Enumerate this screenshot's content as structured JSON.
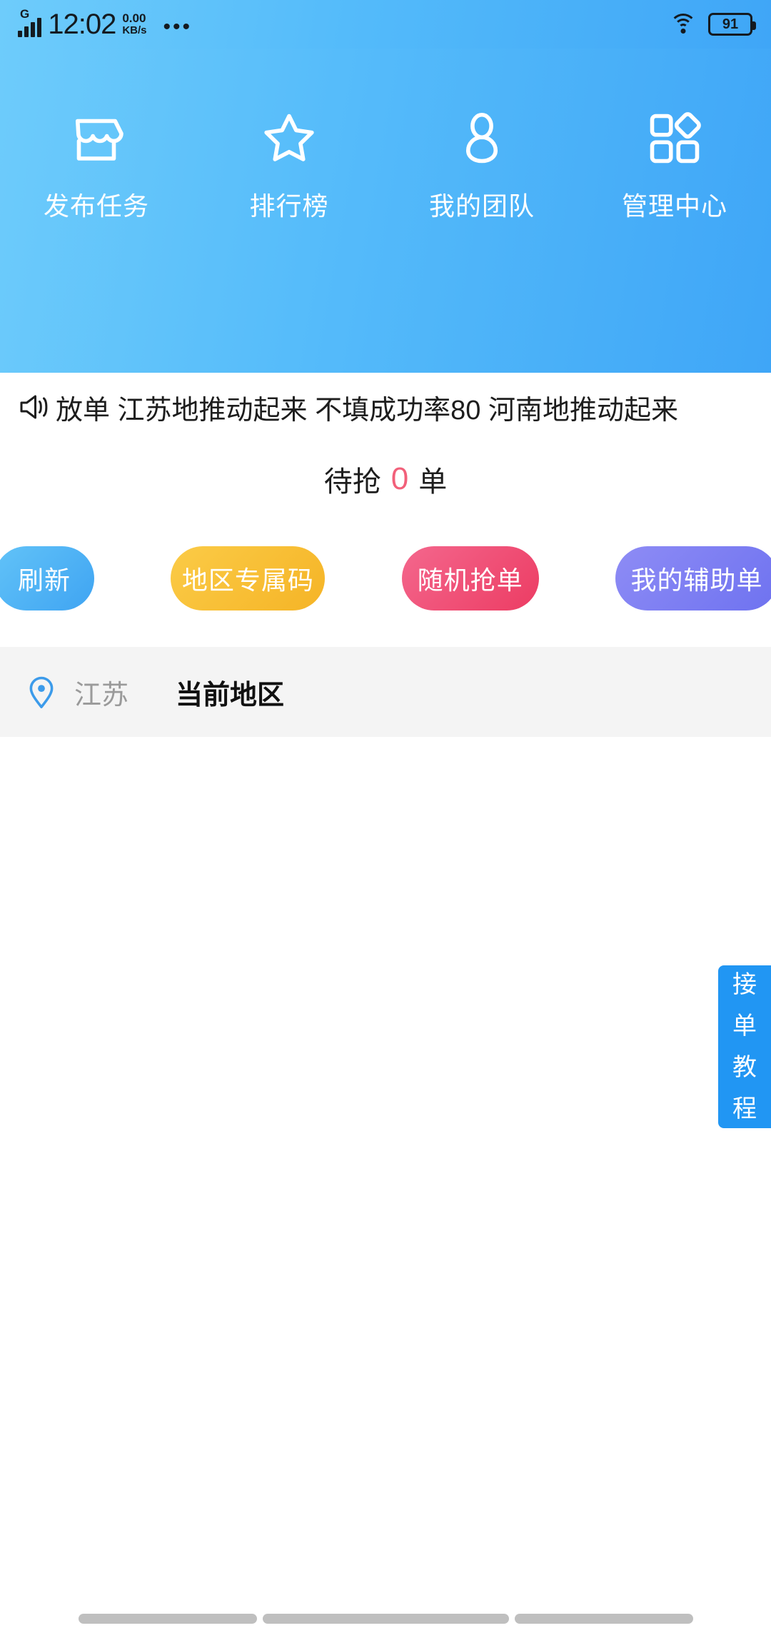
{
  "statusbar": {
    "network_type": "G",
    "time": "12:02",
    "speed_value": "0.00",
    "speed_unit": "KB/s",
    "overflow": "•••",
    "battery": "91"
  },
  "header": {
    "nav": [
      {
        "label": "发布任务",
        "icon": "shop-icon"
      },
      {
        "label": "排行榜",
        "icon": "star-icon"
      },
      {
        "label": "我的团队",
        "icon": "person-icon"
      },
      {
        "label": "管理中心",
        "icon": "grid-icon"
      }
    ]
  },
  "notice": {
    "icon": "megaphone-icon",
    "text": "放单 江苏地推动起来 不填成功率80 河南地推动起来"
  },
  "pending": {
    "prefix": "待抢",
    "count": "0",
    "suffix": "单"
  },
  "actions": {
    "refresh": "刷新",
    "region_code": "地区专属码",
    "random_grab": "随机抢单",
    "my_assist": "我的辅助单"
  },
  "region": {
    "icon": "location-pin-icon",
    "name": "江苏",
    "label": "当前地区"
  },
  "sidetab": {
    "chars": [
      "接",
      "单",
      "教",
      "程"
    ]
  },
  "colors": {
    "header_start": "#6ECCFB",
    "header_end": "#3FA6F7",
    "accent_pink": "#F2607A",
    "btn_refresh": "#3FA4F2",
    "btn_code": "#F5B426",
    "btn_grab": "#EC3C63",
    "btn_assist": "#6E72F0",
    "sidetab": "#2196F3",
    "region_bar": "#F4F4F4"
  }
}
